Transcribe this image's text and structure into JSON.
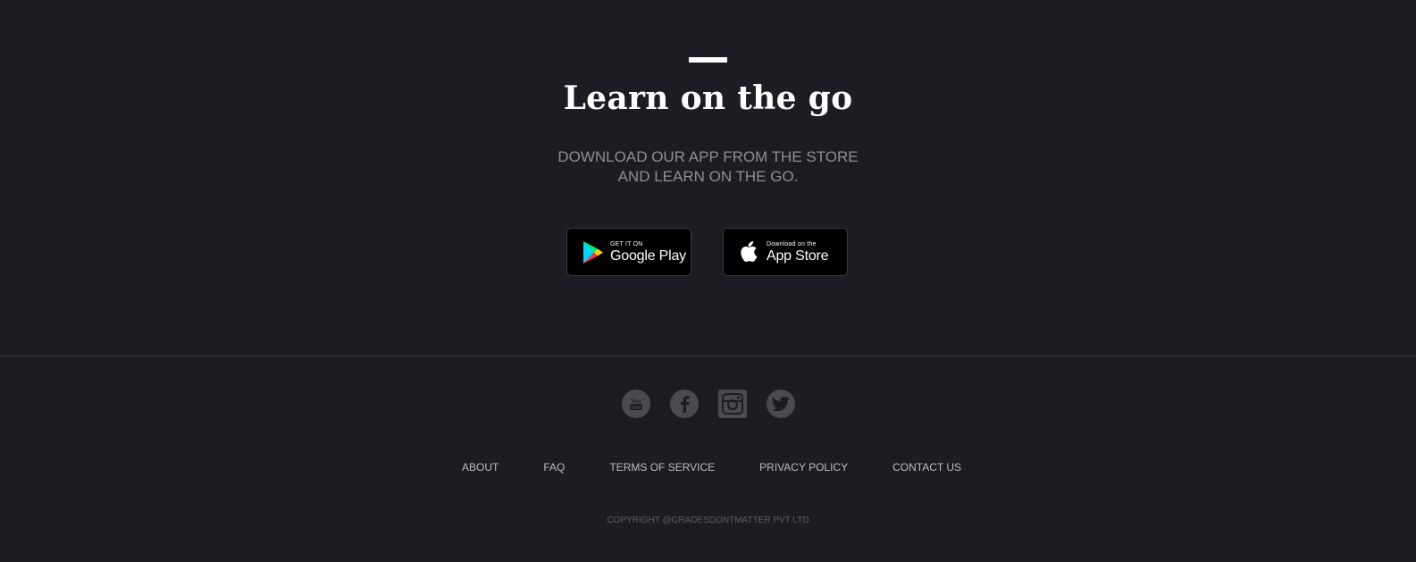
{
  "hero": {
    "title": "Learn on the go",
    "subtitle": "DOWNLOAD OUR APP FROM THE STORE AND LEARN ON THE GO."
  },
  "stores": {
    "google": {
      "small": "GET IT ON",
      "big": "Google Play",
      "icon": "google-play-icon"
    },
    "apple": {
      "small": "Download on the",
      "big": "App Store",
      "icon": "apple-icon"
    }
  },
  "social": [
    {
      "name": "youtube",
      "icon": "youtube-icon"
    },
    {
      "name": "facebook",
      "icon": "facebook-icon"
    },
    {
      "name": "instagram",
      "icon": "instagram-icon"
    },
    {
      "name": "twitter",
      "icon": "twitter-icon"
    }
  ],
  "footer": {
    "links": [
      "ABOUT",
      "FAQ",
      "TERMS OF SERVICE",
      "PRIVACY POLICY",
      "CONTACT US"
    ],
    "copyright": "COPYRIGHT @GRADESDONTMATTER PVT LTD"
  },
  "colors": {
    "background": "#1b1d23",
    "social_icon": "#4a4b50",
    "link": "#bbbdc1"
  }
}
